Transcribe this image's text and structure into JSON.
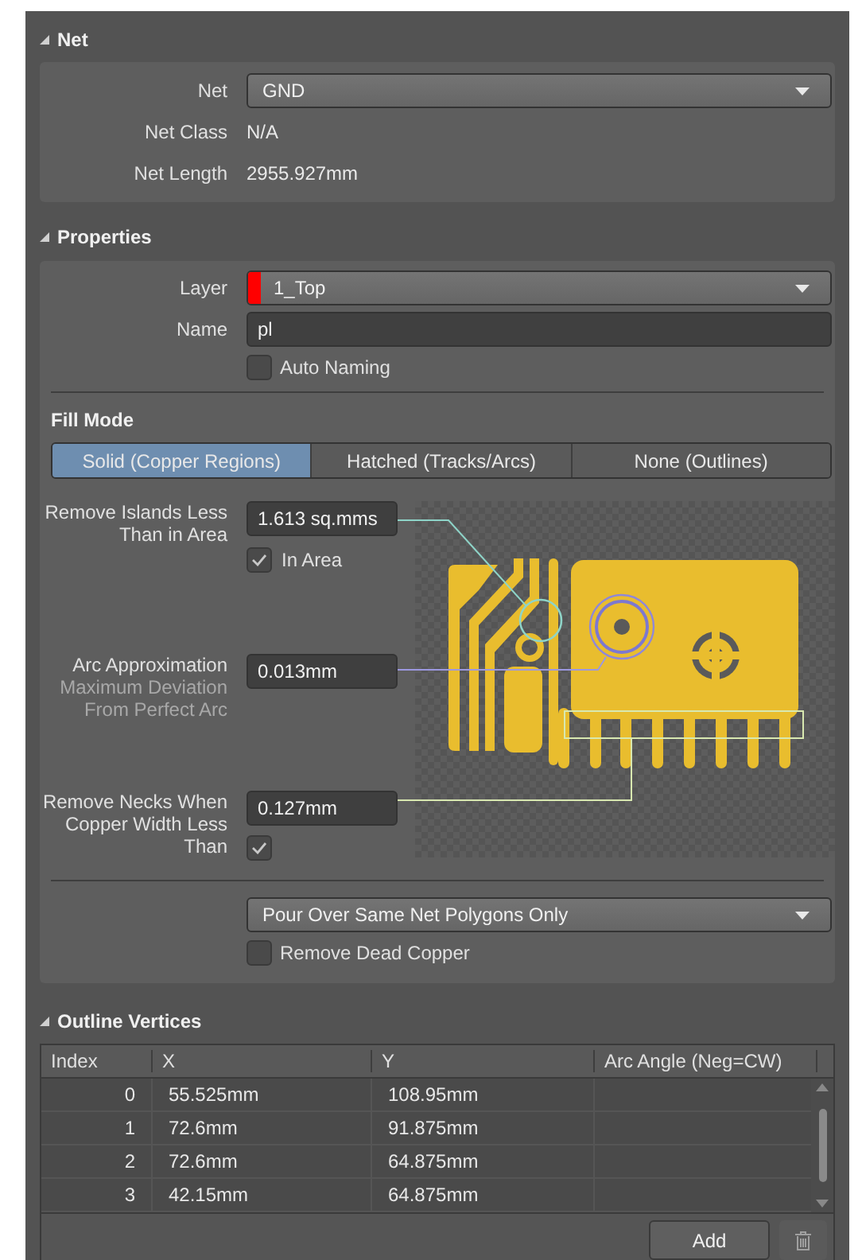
{
  "net_section": {
    "title": "Net",
    "fields": [
      {
        "kind": "dropdown",
        "label": "Net",
        "value": "GND"
      },
      {
        "kind": "text",
        "label": "Net Class",
        "value": "N/A"
      },
      {
        "kind": "text",
        "label": "Net Length",
        "value": "2955.927mm"
      }
    ]
  },
  "properties_section": {
    "title": "Properties",
    "layer": {
      "label": "Layer",
      "value": "1_Top",
      "color": "#ff0000"
    },
    "name": {
      "label": "Name",
      "value": "pl"
    },
    "auto_naming": {
      "label": "Auto Naming",
      "checked": false
    },
    "fill_mode": {
      "title": "Fill Mode",
      "tabs": [
        {
          "label": "Solid (Copper Regions)",
          "selected": true
        },
        {
          "label": "Hatched (Tracks/Arcs)",
          "selected": false
        },
        {
          "label": "None (Outlines)",
          "selected": false
        }
      ],
      "settings": [
        {
          "label": "Remove Islands Less Than in Area",
          "value": "1.613 sq.mms",
          "checkbox": {
            "label": "In Area",
            "checked": true
          }
        },
        {
          "label": "Arc Approximation",
          "sublabel": "Maximum Deviation From Perfect Arc",
          "value": "0.013mm"
        },
        {
          "label": "Remove Necks When Copper Width Less Than",
          "value": "0.127mm",
          "checkbox": {
            "checked": true
          }
        }
      ]
    },
    "pour_option": "Pour Over Same Net Polygons Only",
    "remove_dead_copper": {
      "label": "Remove Dead Copper",
      "checked": false
    }
  },
  "outline_vertices": {
    "title": "Outline Vertices",
    "columns": [
      "Index",
      "X",
      "Y",
      "Arc Angle (Neg=CW)"
    ],
    "rows": [
      {
        "index": "0",
        "x": "55.525mm",
        "y": "108.95mm"
      },
      {
        "index": "1",
        "x": "72.6mm",
        "y": "91.875mm"
      },
      {
        "index": "2",
        "x": "72.6mm",
        "y": "64.875mm"
      },
      {
        "index": "3",
        "x": "42.15mm",
        "y": "64.875mm"
      }
    ],
    "add_button": "Add"
  }
}
